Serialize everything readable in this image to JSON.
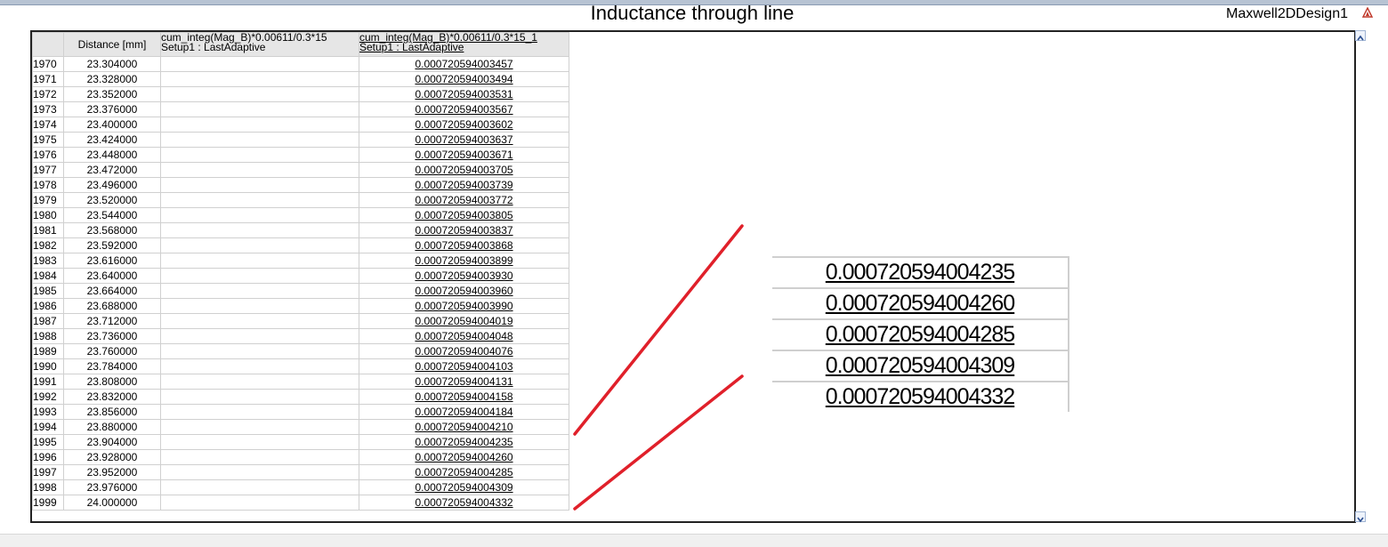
{
  "window": {
    "title": "Inductance through line",
    "design_name": "Maxwell2DDesign1"
  },
  "table": {
    "headers": {
      "distance": "Distance [mm]",
      "col1_line1": "cum_integ(Mag_B)*0.00611/0.3*15",
      "col1_line2": "Setup1 : LastAdaptive",
      "col2_line1": "cum_integ(Mag_B)*0.00611/0.3*15_1",
      "col2_line2": "Setup1 : LastAdaptive"
    },
    "rows": [
      {
        "index": "1970",
        "distance": "23.304000",
        "col1": "",
        "col2": "0.000720594003457"
      },
      {
        "index": "1971",
        "distance": "23.328000",
        "col1": "",
        "col2": "0.000720594003494"
      },
      {
        "index": "1972",
        "distance": "23.352000",
        "col1": "",
        "col2": "0.000720594003531"
      },
      {
        "index": "1973",
        "distance": "23.376000",
        "col1": "",
        "col2": "0.000720594003567"
      },
      {
        "index": "1974",
        "distance": "23.400000",
        "col1": "",
        "col2": "0.000720594003602"
      },
      {
        "index": "1975",
        "distance": "23.424000",
        "col1": "",
        "col2": "0.000720594003637"
      },
      {
        "index": "1976",
        "distance": "23.448000",
        "col1": "",
        "col2": "0.000720594003671"
      },
      {
        "index": "1977",
        "distance": "23.472000",
        "col1": "",
        "col2": "0.000720594003705"
      },
      {
        "index": "1978",
        "distance": "23.496000",
        "col1": "",
        "col2": "0.000720594003739"
      },
      {
        "index": "1979",
        "distance": "23.520000",
        "col1": "",
        "col2": "0.000720594003772"
      },
      {
        "index": "1980",
        "distance": "23.544000",
        "col1": "",
        "col2": "0.000720594003805"
      },
      {
        "index": "1981",
        "distance": "23.568000",
        "col1": "",
        "col2": "0.000720594003837"
      },
      {
        "index": "1982",
        "distance": "23.592000",
        "col1": "",
        "col2": "0.000720594003868"
      },
      {
        "index": "1983",
        "distance": "23.616000",
        "col1": "",
        "col2": "0.000720594003899"
      },
      {
        "index": "1984",
        "distance": "23.640000",
        "col1": "",
        "col2": "0.000720594003930"
      },
      {
        "index": "1985",
        "distance": "23.664000",
        "col1": "",
        "col2": "0.000720594003960"
      },
      {
        "index": "1986",
        "distance": "23.688000",
        "col1": "",
        "col2": "0.000720594003990"
      },
      {
        "index": "1987",
        "distance": "23.712000",
        "col1": "",
        "col2": "0.000720594004019"
      },
      {
        "index": "1988",
        "distance": "23.736000",
        "col1": "",
        "col2": "0.000720594004048"
      },
      {
        "index": "1989",
        "distance": "23.760000",
        "col1": "",
        "col2": "0.000720594004076"
      },
      {
        "index": "1990",
        "distance": "23.784000",
        "col1": "",
        "col2": "0.000720594004103"
      },
      {
        "index": "1991",
        "distance": "23.808000",
        "col1": "",
        "col2": "0.000720594004131"
      },
      {
        "index": "1992",
        "distance": "23.832000",
        "col1": "",
        "col2": "0.000720594004158"
      },
      {
        "index": "1993",
        "distance": "23.856000",
        "col1": "",
        "col2": "0.000720594004184"
      },
      {
        "index": "1994",
        "distance": "23.880000",
        "col1": "",
        "col2": "0.000720594004210"
      },
      {
        "index": "1995",
        "distance": "23.904000",
        "col1": "",
        "col2": "0.000720594004235"
      },
      {
        "index": "1996",
        "distance": "23.928000",
        "col1": "",
        "col2": "0.000720594004260"
      },
      {
        "index": "1997",
        "distance": "23.952000",
        "col1": "",
        "col2": "0.000720594004285"
      },
      {
        "index": "1998",
        "distance": "23.976000",
        "col1": "",
        "col2": "0.000720594004309"
      },
      {
        "index": "1999",
        "distance": "24.000000",
        "col1": "",
        "col2": "0.000720594004332"
      }
    ]
  },
  "zoom": {
    "values": [
      "0.000720594004235",
      "0.000720594004260",
      "0.000720594004285",
      "0.000720594004309",
      "0.000720594004332"
    ]
  },
  "colors": {
    "callout": "#e0202a",
    "header_bg": "#e6e6e6",
    "grid_line": "#d0d0d0"
  },
  "icons": {
    "corner": "maxwell-logo-icon",
    "scroll_up": "scroll-up-arrow-icon",
    "scroll_down": "scroll-down-arrow-icon"
  }
}
